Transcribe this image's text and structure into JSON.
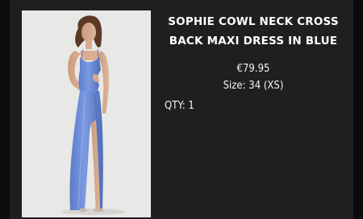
{
  "product": {
    "title_line1": "SOPHIE COWL NECK CROSS",
    "title_line2": "BACK MAXI DRESS IN BLUE",
    "price": "€79.95",
    "size_label": "Size:",
    "size_value": "34 (XS)",
    "qty_label": "QTY:",
    "qty_value": "1",
    "image_subject": "model-in-blue-satin-maxi-dress",
    "dress_color": "#6f8fd8"
  },
  "colors": {
    "page_bg": "#0b0b0d",
    "card_bg": "#1f1f22",
    "photo_bg": "#e7e7e4",
    "text": "#ffffff"
  }
}
